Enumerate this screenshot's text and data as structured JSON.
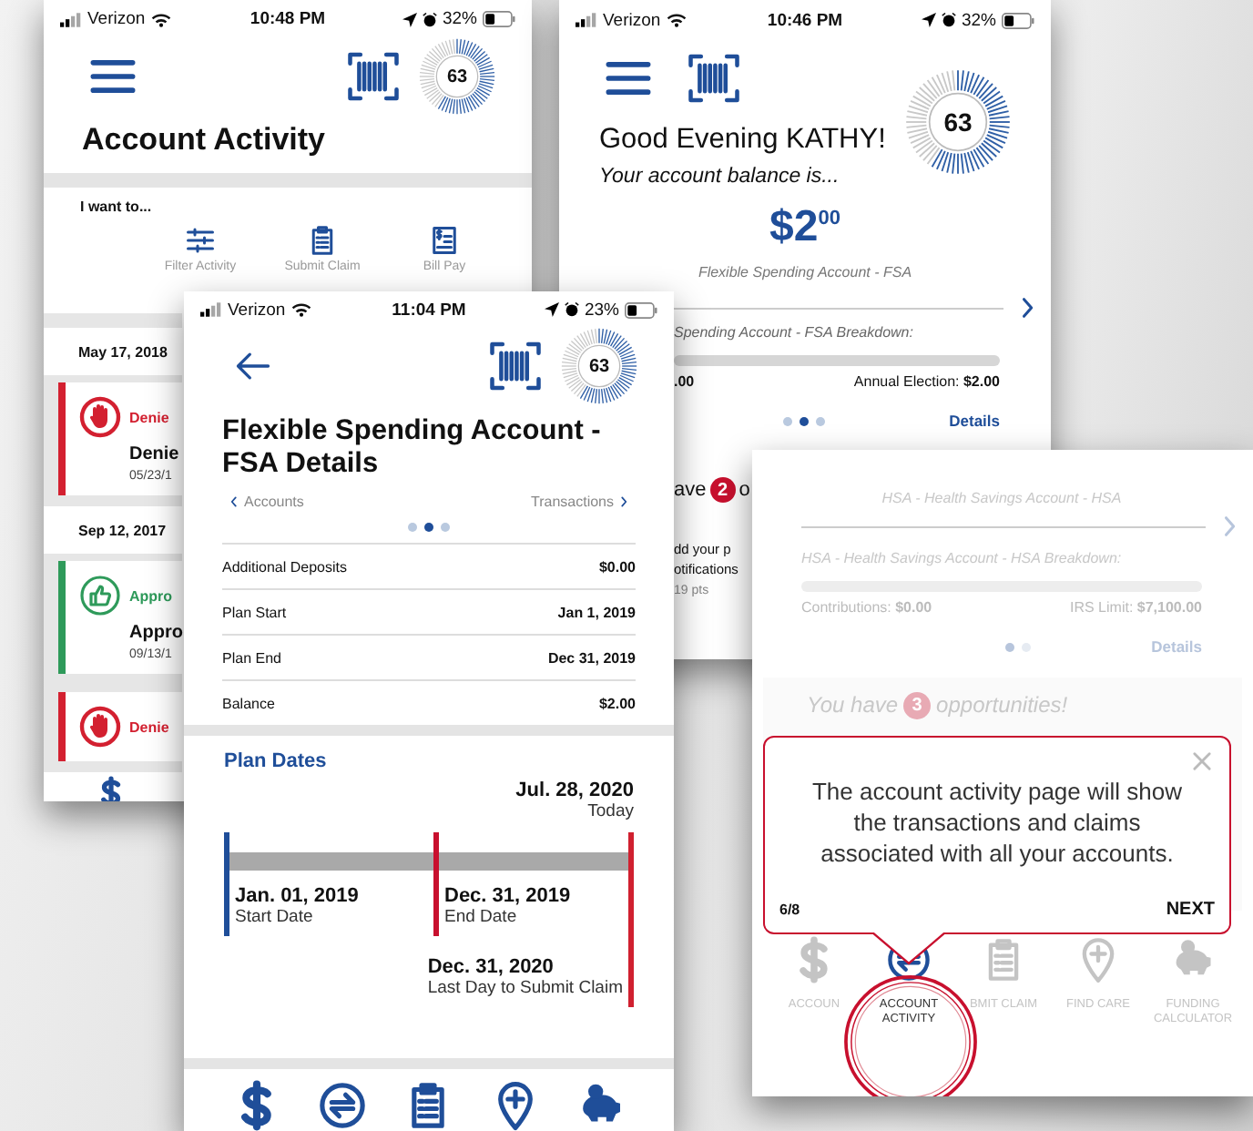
{
  "account_activity_screen": {
    "status_bar": {
      "carrier": "Verizon",
      "time": "10:48 PM",
      "battery": "32%"
    },
    "score": "63",
    "title": "Account Activity",
    "prompt": "I want to...",
    "actions": [
      {
        "label": "Filter Activity"
      },
      {
        "label": "Submit Claim"
      },
      {
        "label": "Bill Pay"
      }
    ],
    "groups": [
      {
        "date": "May 17, 2018",
        "claims": [
          {
            "kind": "denied",
            "status": "Denie",
            "title": "Denie",
            "date": "05/23/1"
          }
        ]
      },
      {
        "date": "Sep 12, 2017",
        "claims": [
          {
            "kind": "approved",
            "status": "Appro",
            "title": "Appro",
            "date": "09/13/1"
          },
          {
            "kind": "denied",
            "status": "Denie"
          }
        ]
      }
    ]
  },
  "home_screen": {
    "status_bar": {
      "carrier": "Verizon",
      "time": "10:46 PM",
      "battery": "32%"
    },
    "score": "63",
    "greeting": "Good Evening KATHY!",
    "balance_intro": "Your account balance is...",
    "balance_dollars": "$2",
    "balance_cents": "00",
    "account_name": "Flexible Spending Account - FSA",
    "breakdown_title": "Spending Account - FSA Breakdown:",
    "contributions": ".00",
    "annual_election": "Annual Election: **$2.00**",
    "pager": [
      {
        "selected": false
      },
      {
        "selected": true
      },
      {
        "selected": false
      }
    ],
    "details_link": "Details",
    "opportunities": {
      "before": "ave",
      "count": "2",
      "after": "o"
    },
    "notice_lines": [
      "dd your p",
      "otifications"
    ],
    "points": "19 pts"
  },
  "fsa_details_screen": {
    "status_bar": {
      "carrier": "Verizon",
      "time": "11:04 PM",
      "battery": "23%"
    },
    "score": "63",
    "title": "Flexible Spending Account - FSA Details",
    "prev_link": "Accounts",
    "next_link": "Transactions",
    "pager": [
      {
        "selected": false
      },
      {
        "selected": true
      },
      {
        "selected": false
      }
    ],
    "rows": [
      {
        "label": "Additional Deposits",
        "value": "$0.00"
      },
      {
        "label": "Plan Start",
        "value": "Jan 1, 2019"
      },
      {
        "label": "Plan End",
        "value": "Dec 31, 2019"
      },
      {
        "label": "Balance",
        "value": "$2.00"
      }
    ],
    "plan_dates_title": "Plan Dates",
    "today": {
      "date": "Jul. 28, 2020",
      "label": "Today"
    },
    "milestones": [
      {
        "kind": "start",
        "date": "Jan. 01, 2019",
        "label": "Start Date"
      },
      {
        "kind": "end",
        "date": "Dec. 31, 2019",
        "label": "End Date"
      },
      {
        "kind": "deadline",
        "date": "Dec. 31, 2020",
        "label": "Last Day to Submit Claim"
      }
    ]
  },
  "tutorial_screen": {
    "account_name": "HSA - Health Savings Account - HSA",
    "breakdown_title": "HSA - Health Savings Account - HSA Breakdown:",
    "contributions": "Contributions: **$0.00**",
    "limit": "IRS Limit: **$7,100.00**",
    "pager": [
      {
        "selected": true
      },
      {
        "selected": false
      }
    ],
    "details_link": "Details",
    "opportunities": {
      "before": "You have",
      "count": "3",
      "after": "opportunities!"
    },
    "tip": {
      "text": "The account activity page will show the transactions and claims associated with all your accounts.",
      "step": "6/8",
      "next": "NEXT"
    },
    "nav": [
      {
        "label": "ACCOUN",
        "selected": false
      },
      {
        "label": "ACCOUNT ACTIVITY",
        "selected": true
      },
      {
        "label": "BMIT CLAIM",
        "selected": false
      },
      {
        "label": "FIND CARE",
        "selected": false
      },
      {
        "label": "FUNDING CALCULATOR",
        "selected": false
      }
    ]
  }
}
